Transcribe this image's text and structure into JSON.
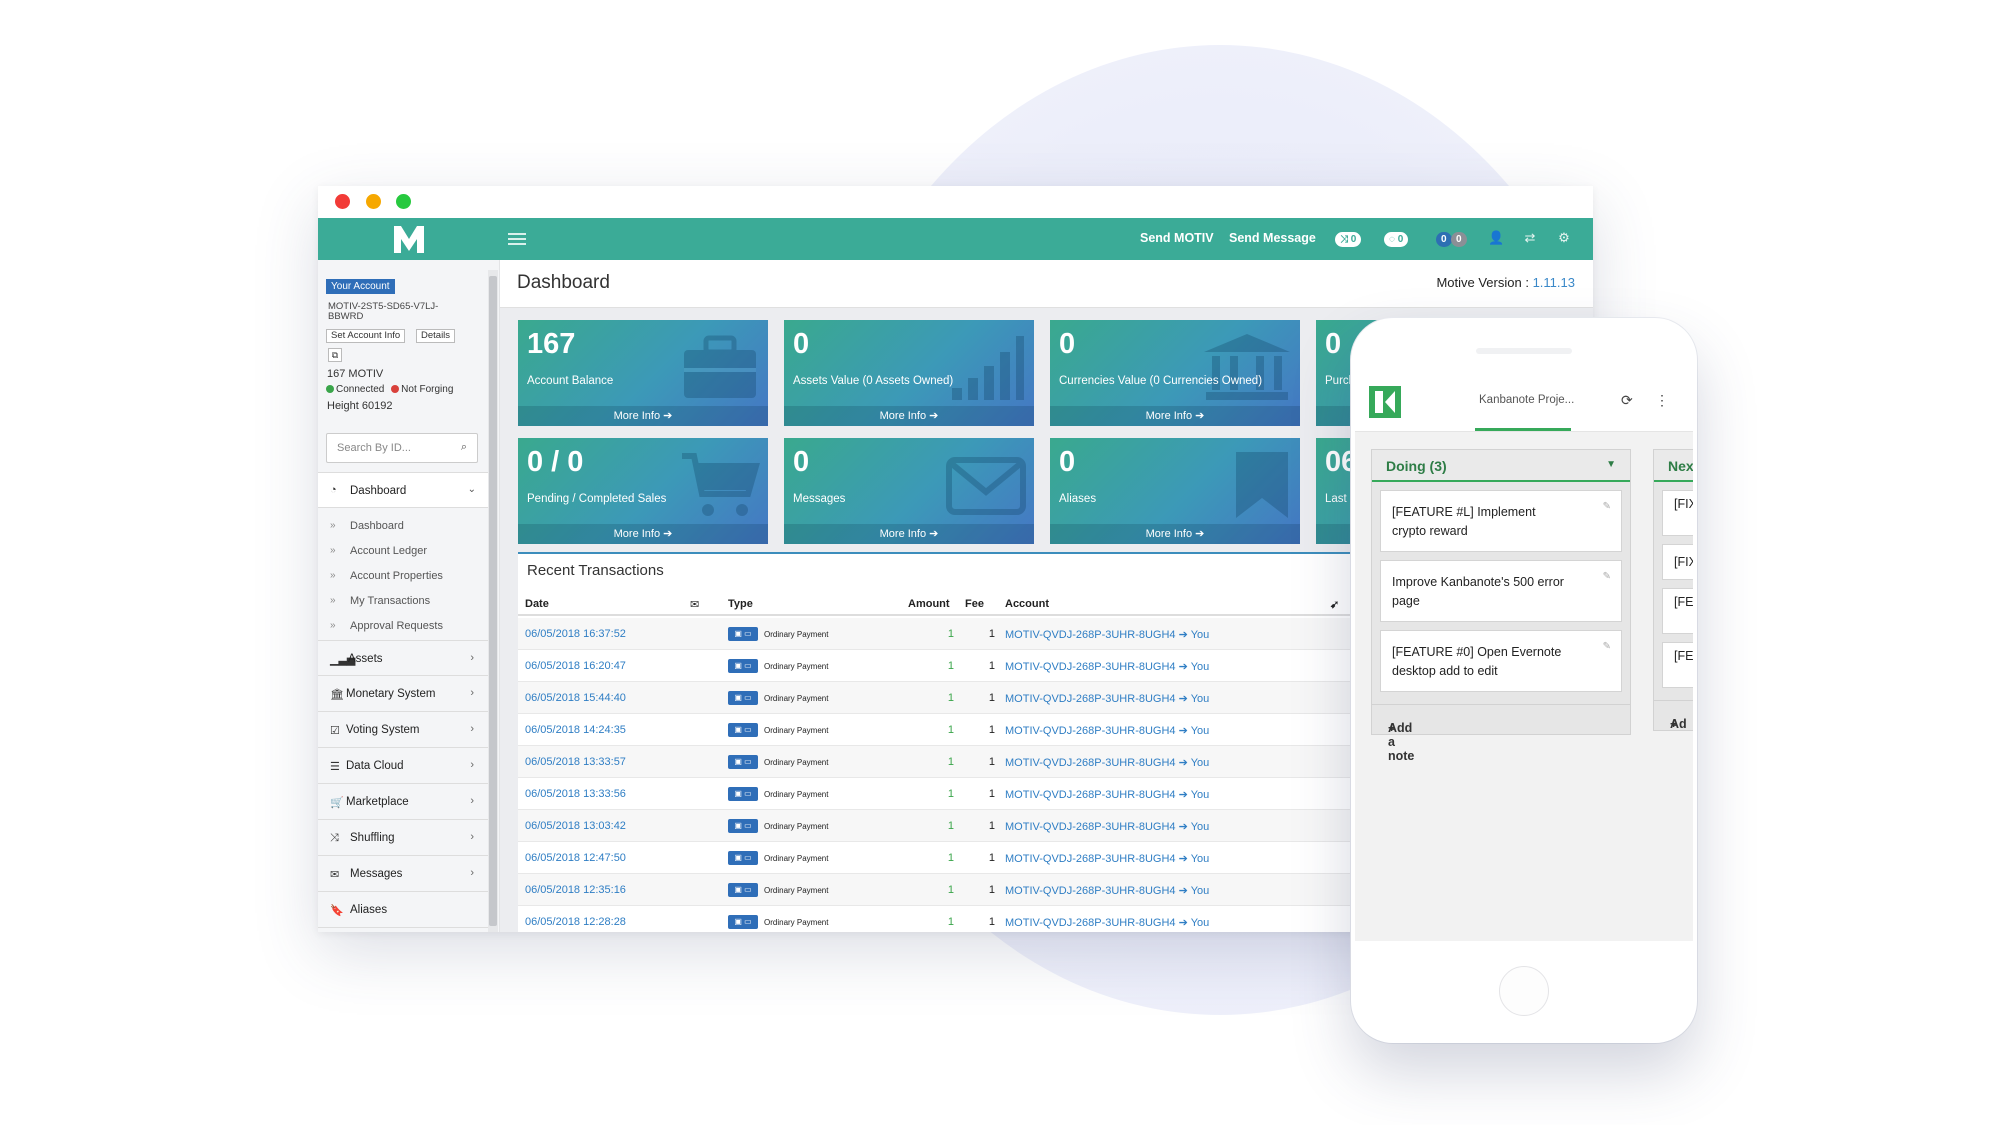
{
  "app": {
    "send_motiv": "Send MOTIV",
    "send_message": "Send Message",
    "pill1": "0",
    "pill2": "0",
    "pill3a": "0",
    "pill3b": "0"
  },
  "sidebar": {
    "account_badge": "Your Account",
    "account_id": "MOTIV-2ST5-SD65-V7LJ-BBWRD",
    "set_account_info": "Set Account Info",
    "details": "Details",
    "balance": "167  MOTIV",
    "connected": "Connected",
    "not_forging": "Not Forging",
    "height": "Height 60192",
    "search_placeholder": "Search By ID...",
    "dashboard_head": "Dashboard",
    "subitems": [
      "Dashboard",
      "Account Ledger",
      "Account Properties",
      "My Transactions",
      "Approval Requests"
    ],
    "items": [
      "Assets",
      "Monetary System",
      "Voting System",
      "Data Cloud",
      "Marketplace",
      "Shuffling",
      "Messages",
      "Aliases"
    ]
  },
  "page": {
    "title": "Dashboard",
    "version_label": "Motive Version :",
    "version": "1.11.13"
  },
  "cards": [
    {
      "value": "167",
      "label": "Account Balance",
      "more": "More Info"
    },
    {
      "value": "0",
      "label": "Assets Value (0 Assets Owned)",
      "more": "More Info"
    },
    {
      "value": "0",
      "label": "Currencies Value (0 Currencies Owned)",
      "more": "More Info"
    },
    {
      "value": "0",
      "label": "Purch",
      "more": ""
    },
    {
      "value": "0 / 0",
      "label": "Pending / Completed Sales",
      "more": "More Info"
    },
    {
      "value": "0",
      "label": "Messages",
      "more": "More Info"
    },
    {
      "value": "0",
      "label": "Aliases",
      "more": "More Info"
    },
    {
      "value": "06",
      "label": "Last U",
      "more": ""
    }
  ],
  "transactions": {
    "title": "Recent Transactions",
    "headers": {
      "date": "Date",
      "type": "Type",
      "amount": "Amount",
      "fee": "Fee",
      "account": "Account"
    },
    "rows": [
      {
        "date": "06/05/2018 16:37:52",
        "type": "Ordinary Payment",
        "amount": "1",
        "fee": "1",
        "account": "MOTIV-QVDJ-268P-3UHR-8UGH4",
        "you": "You"
      },
      {
        "date": "06/05/2018 16:20:47",
        "type": "Ordinary Payment",
        "amount": "1",
        "fee": "1",
        "account": "MOTIV-QVDJ-268P-3UHR-8UGH4",
        "you": "You"
      },
      {
        "date": "06/05/2018 15:44:40",
        "type": "Ordinary Payment",
        "amount": "1",
        "fee": "1",
        "account": "MOTIV-QVDJ-268P-3UHR-8UGH4",
        "you": "You"
      },
      {
        "date": "06/05/2018 14:24:35",
        "type": "Ordinary Payment",
        "amount": "1",
        "fee": "1",
        "account": "MOTIV-QVDJ-268P-3UHR-8UGH4",
        "you": "You"
      },
      {
        "date": "06/05/2018 13:33:57",
        "type": "Ordinary Payment",
        "amount": "1",
        "fee": "1",
        "account": "MOTIV-QVDJ-268P-3UHR-8UGH4",
        "you": "You"
      },
      {
        "date": "06/05/2018 13:33:56",
        "type": "Ordinary Payment",
        "amount": "1",
        "fee": "1",
        "account": "MOTIV-QVDJ-268P-3UHR-8UGH4",
        "you": "You"
      },
      {
        "date": "06/05/2018 13:03:42",
        "type": "Ordinary Payment",
        "amount": "1",
        "fee": "1",
        "account": "MOTIV-QVDJ-268P-3UHR-8UGH4",
        "you": "You"
      },
      {
        "date": "06/05/2018 12:47:50",
        "type": "Ordinary Payment",
        "amount": "1",
        "fee": "1",
        "account": "MOTIV-QVDJ-268P-3UHR-8UGH4",
        "you": "You"
      },
      {
        "date": "06/05/2018 12:35:16",
        "type": "Ordinary Payment",
        "amount": "1",
        "fee": "1",
        "account": "MOTIV-QVDJ-268P-3UHR-8UGH4",
        "you": "You"
      },
      {
        "date": "06/05/2018 12:28:28",
        "type": "Ordinary Payment",
        "amount": "1",
        "fee": "1",
        "account": "MOTIV-QVDJ-268P-3UHR-8UGH4",
        "you": "You"
      }
    ]
  },
  "phone": {
    "title": "Kanbanote Proje...",
    "column1": {
      "title": "Doing (3)",
      "notes": [
        "[FEATURE #L] Implement crypto reward",
        "Improve Kanbanote's 500 error page",
        "[FEATURE #0] Open Evernote desktop add to edit"
      ],
      "add": "Add a note"
    },
    "column2": {
      "title": "Next",
      "notes": [
        "[FIX Boo",
        "[FIX",
        "[FEA mo",
        "[FEA Sea"
      ],
      "add": "Ad"
    }
  },
  "colors": {
    "appbar": "#3bab97",
    "link": "#2f7ec4",
    "kanban_green": "#36a95a"
  }
}
